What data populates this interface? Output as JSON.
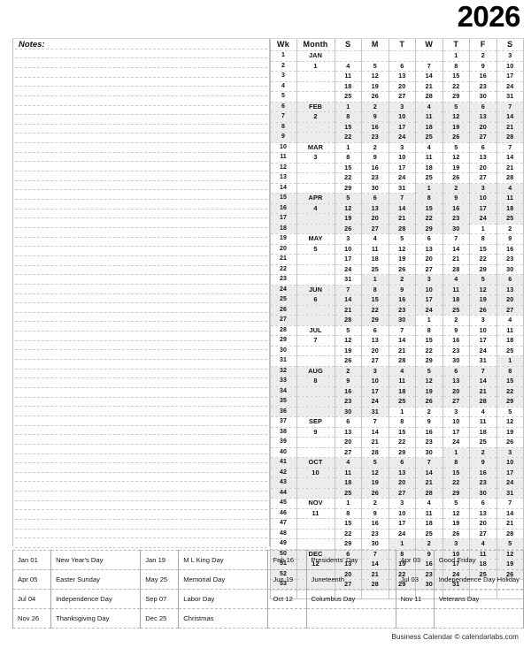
{
  "year": "2026",
  "notes": {
    "label": "Notes:",
    "line_count": 54
  },
  "footer": "Business Calendar © calendarlabs.com",
  "calendar": {
    "headers": [
      "Wk",
      "Month",
      "S",
      "M",
      "T",
      "W",
      "T",
      "F",
      "S"
    ],
    "month_names": [
      "JAN",
      "FEB",
      "MAR",
      "APR",
      "MAY",
      "JUN",
      "JUL",
      "AUG",
      "SEP",
      "OCT",
      "NOV",
      "DEC"
    ],
    "rows": [
      {
        "wk": "1",
        "month": "JAN",
        "num": "",
        "days": [
          "",
          "",
          "",
          "",
          "1",
          "2",
          "3"
        ],
        "months": [
          0,
          0,
          0,
          0,
          1,
          1,
          1
        ]
      },
      {
        "wk": "2",
        "month": "",
        "num": "1",
        "days": [
          "4",
          "5",
          "6",
          "7",
          "8",
          "9",
          "10"
        ],
        "months": [
          1,
          1,
          1,
          1,
          1,
          1,
          1
        ]
      },
      {
        "wk": "3",
        "month": "",
        "num": "",
        "days": [
          "11",
          "12",
          "13",
          "14",
          "15",
          "16",
          "17"
        ],
        "months": [
          1,
          1,
          1,
          1,
          1,
          1,
          1
        ]
      },
      {
        "wk": "4",
        "month": "",
        "num": "",
        "days": [
          "18",
          "19",
          "20",
          "21",
          "22",
          "23",
          "24"
        ],
        "months": [
          1,
          1,
          1,
          1,
          1,
          1,
          1
        ]
      },
      {
        "wk": "5",
        "month": "",
        "num": "",
        "days": [
          "25",
          "26",
          "27",
          "28",
          "29",
          "30",
          "31"
        ],
        "months": [
          1,
          1,
          1,
          1,
          1,
          1,
          1
        ]
      },
      {
        "wk": "6",
        "month": "FEB",
        "num": "",
        "days": [
          "1",
          "2",
          "3",
          "4",
          "5",
          "6",
          "7"
        ],
        "months": [
          2,
          2,
          2,
          2,
          2,
          2,
          2
        ]
      },
      {
        "wk": "7",
        "month": "",
        "num": "2",
        "days": [
          "8",
          "9",
          "10",
          "11",
          "12",
          "13",
          "14"
        ],
        "months": [
          2,
          2,
          2,
          2,
          2,
          2,
          2
        ]
      },
      {
        "wk": "8",
        "month": "",
        "num": "",
        "days": [
          "15",
          "16",
          "17",
          "18",
          "19",
          "20",
          "21"
        ],
        "months": [
          2,
          2,
          2,
          2,
          2,
          2,
          2
        ]
      },
      {
        "wk": "9",
        "month": "",
        "num": "",
        "days": [
          "22",
          "23",
          "24",
          "25",
          "26",
          "27",
          "28"
        ],
        "months": [
          2,
          2,
          2,
          2,
          2,
          2,
          2
        ]
      },
      {
        "wk": "10",
        "month": "MAR",
        "num": "",
        "days": [
          "1",
          "2",
          "3",
          "4",
          "5",
          "6",
          "7"
        ],
        "months": [
          3,
          3,
          3,
          3,
          3,
          3,
          3
        ]
      },
      {
        "wk": "11",
        "month": "",
        "num": "3",
        "days": [
          "8",
          "9",
          "10",
          "11",
          "12",
          "13",
          "14"
        ],
        "months": [
          3,
          3,
          3,
          3,
          3,
          3,
          3
        ]
      },
      {
        "wk": "12",
        "month": "",
        "num": "",
        "days": [
          "15",
          "16",
          "17",
          "18",
          "19",
          "20",
          "21"
        ],
        "months": [
          3,
          3,
          3,
          3,
          3,
          3,
          3
        ]
      },
      {
        "wk": "13",
        "month": "",
        "num": "",
        "days": [
          "22",
          "23",
          "24",
          "25",
          "26",
          "27",
          "28"
        ],
        "months": [
          3,
          3,
          3,
          3,
          3,
          3,
          3
        ]
      },
      {
        "wk": "14",
        "month": "",
        "num": "",
        "days": [
          "29",
          "30",
          "31",
          "1",
          "2",
          "3",
          "4"
        ],
        "months": [
          3,
          3,
          3,
          4,
          4,
          4,
          4
        ]
      },
      {
        "wk": "15",
        "month": "APR",
        "num": "",
        "days": [
          "5",
          "6",
          "7",
          "8",
          "9",
          "10",
          "11"
        ],
        "months": [
          4,
          4,
          4,
          4,
          4,
          4,
          4
        ]
      },
      {
        "wk": "16",
        "month": "",
        "num": "4",
        "days": [
          "12",
          "13",
          "14",
          "15",
          "16",
          "17",
          "18"
        ],
        "months": [
          4,
          4,
          4,
          4,
          4,
          4,
          4
        ]
      },
      {
        "wk": "17",
        "month": "",
        "num": "",
        "days": [
          "19",
          "20",
          "21",
          "22",
          "23",
          "24",
          "25"
        ],
        "months": [
          4,
          4,
          4,
          4,
          4,
          4,
          4
        ]
      },
      {
        "wk": "18",
        "month": "",
        "num": "",
        "days": [
          "26",
          "27",
          "28",
          "29",
          "30",
          "1",
          "2"
        ],
        "months": [
          4,
          4,
          4,
          4,
          4,
          5,
          5
        ]
      },
      {
        "wk": "19",
        "month": "MAY",
        "num": "",
        "days": [
          "3",
          "4",
          "5",
          "6",
          "7",
          "8",
          "9"
        ],
        "months": [
          5,
          5,
          5,
          5,
          5,
          5,
          5
        ]
      },
      {
        "wk": "20",
        "month": "",
        "num": "5",
        "days": [
          "10",
          "11",
          "12",
          "13",
          "14",
          "15",
          "16"
        ],
        "months": [
          5,
          5,
          5,
          5,
          5,
          5,
          5
        ]
      },
      {
        "wk": "21",
        "month": "",
        "num": "",
        "days": [
          "17",
          "18",
          "19",
          "20",
          "21",
          "22",
          "23"
        ],
        "months": [
          5,
          5,
          5,
          5,
          5,
          5,
          5
        ]
      },
      {
        "wk": "22",
        "month": "",
        "num": "",
        "days": [
          "24",
          "25",
          "26",
          "27",
          "28",
          "29",
          "30"
        ],
        "months": [
          5,
          5,
          5,
          5,
          5,
          5,
          5
        ]
      },
      {
        "wk": "23",
        "month": "",
        "num": "",
        "days": [
          "31",
          "1",
          "2",
          "3",
          "4",
          "5",
          "6"
        ],
        "months": [
          5,
          6,
          6,
          6,
          6,
          6,
          6
        ]
      },
      {
        "wk": "24",
        "month": "JUN",
        "num": "",
        "days": [
          "7",
          "8",
          "9",
          "10",
          "11",
          "12",
          "13"
        ],
        "months": [
          6,
          6,
          6,
          6,
          6,
          6,
          6
        ]
      },
      {
        "wk": "25",
        "month": "",
        "num": "6",
        "days": [
          "14",
          "15",
          "16",
          "17",
          "18",
          "19",
          "20"
        ],
        "months": [
          6,
          6,
          6,
          6,
          6,
          6,
          6
        ]
      },
      {
        "wk": "26",
        "month": "",
        "num": "",
        "days": [
          "21",
          "22",
          "23",
          "24",
          "25",
          "26",
          "27"
        ],
        "months": [
          6,
          6,
          6,
          6,
          6,
          6,
          6
        ]
      },
      {
        "wk": "27",
        "month": "",
        "num": "",
        "days": [
          "28",
          "29",
          "30",
          "1",
          "2",
          "3",
          "4"
        ],
        "months": [
          6,
          6,
          6,
          7,
          7,
          7,
          7
        ]
      },
      {
        "wk": "28",
        "month": "JUL",
        "num": "",
        "days": [
          "5",
          "6",
          "7",
          "8",
          "9",
          "10",
          "11"
        ],
        "months": [
          7,
          7,
          7,
          7,
          7,
          7,
          7
        ]
      },
      {
        "wk": "29",
        "month": "",
        "num": "7",
        "days": [
          "12",
          "13",
          "14",
          "15",
          "16",
          "17",
          "18"
        ],
        "months": [
          7,
          7,
          7,
          7,
          7,
          7,
          7
        ]
      },
      {
        "wk": "30",
        "month": "",
        "num": "",
        "days": [
          "19",
          "20",
          "21",
          "22",
          "23",
          "24",
          "25"
        ],
        "months": [
          7,
          7,
          7,
          7,
          7,
          7,
          7
        ]
      },
      {
        "wk": "31",
        "month": "",
        "num": "",
        "days": [
          "26",
          "27",
          "28",
          "29",
          "30",
          "31",
          "1"
        ],
        "months": [
          7,
          7,
          7,
          7,
          7,
          7,
          8
        ]
      },
      {
        "wk": "32",
        "month": "AUG",
        "num": "",
        "days": [
          "2",
          "3",
          "4",
          "5",
          "6",
          "7",
          "8"
        ],
        "months": [
          8,
          8,
          8,
          8,
          8,
          8,
          8
        ]
      },
      {
        "wk": "33",
        "month": "",
        "num": "8",
        "days": [
          "9",
          "10",
          "11",
          "12",
          "13",
          "14",
          "15"
        ],
        "months": [
          8,
          8,
          8,
          8,
          8,
          8,
          8
        ]
      },
      {
        "wk": "34",
        "month": "",
        "num": "",
        "days": [
          "16",
          "17",
          "18",
          "19",
          "20",
          "21",
          "22"
        ],
        "months": [
          8,
          8,
          8,
          8,
          8,
          8,
          8
        ]
      },
      {
        "wk": "35",
        "month": "",
        "num": "",
        "days": [
          "23",
          "24",
          "25",
          "26",
          "27",
          "28",
          "29"
        ],
        "months": [
          8,
          8,
          8,
          8,
          8,
          8,
          8
        ]
      },
      {
        "wk": "36",
        "month": "",
        "num": "",
        "days": [
          "30",
          "31",
          "1",
          "2",
          "3",
          "4",
          "5"
        ],
        "months": [
          8,
          8,
          9,
          9,
          9,
          9,
          9
        ]
      },
      {
        "wk": "37",
        "month": "SEP",
        "num": "",
        "days": [
          "6",
          "7",
          "8",
          "9",
          "10",
          "11",
          "12"
        ],
        "months": [
          9,
          9,
          9,
          9,
          9,
          9,
          9
        ]
      },
      {
        "wk": "38",
        "month": "",
        "num": "9",
        "days": [
          "13",
          "14",
          "15",
          "16",
          "17",
          "18",
          "19"
        ],
        "months": [
          9,
          9,
          9,
          9,
          9,
          9,
          9
        ]
      },
      {
        "wk": "39",
        "month": "",
        "num": "",
        "days": [
          "20",
          "21",
          "22",
          "23",
          "24",
          "25",
          "26"
        ],
        "months": [
          9,
          9,
          9,
          9,
          9,
          9,
          9
        ]
      },
      {
        "wk": "40",
        "month": "",
        "num": "",
        "days": [
          "27",
          "28",
          "29",
          "30",
          "1",
          "2",
          "3"
        ],
        "months": [
          9,
          9,
          9,
          9,
          10,
          10,
          10
        ]
      },
      {
        "wk": "41",
        "month": "OCT",
        "num": "",
        "days": [
          "4",
          "5",
          "6",
          "7",
          "8",
          "9",
          "10"
        ],
        "months": [
          10,
          10,
          10,
          10,
          10,
          10,
          10
        ]
      },
      {
        "wk": "42",
        "month": "",
        "num": "10",
        "days": [
          "11",
          "12",
          "13",
          "14",
          "15",
          "16",
          "17"
        ],
        "months": [
          10,
          10,
          10,
          10,
          10,
          10,
          10
        ]
      },
      {
        "wk": "43",
        "month": "",
        "num": "",
        "days": [
          "18",
          "19",
          "20",
          "21",
          "22",
          "23",
          "24"
        ],
        "months": [
          10,
          10,
          10,
          10,
          10,
          10,
          10
        ]
      },
      {
        "wk": "44",
        "month": "",
        "num": "",
        "days": [
          "25",
          "26",
          "27",
          "28",
          "29",
          "30",
          "31"
        ],
        "months": [
          10,
          10,
          10,
          10,
          10,
          10,
          10
        ]
      },
      {
        "wk": "45",
        "month": "NOV",
        "num": "",
        "days": [
          "1",
          "2",
          "3",
          "4",
          "5",
          "6",
          "7"
        ],
        "months": [
          11,
          11,
          11,
          11,
          11,
          11,
          11
        ]
      },
      {
        "wk": "46",
        "month": "",
        "num": "11",
        "days": [
          "8",
          "9",
          "10",
          "11",
          "12",
          "13",
          "14"
        ],
        "months": [
          11,
          11,
          11,
          11,
          11,
          11,
          11
        ]
      },
      {
        "wk": "47",
        "month": "",
        "num": "",
        "days": [
          "15",
          "16",
          "17",
          "18",
          "19",
          "20",
          "21"
        ],
        "months": [
          11,
          11,
          11,
          11,
          11,
          11,
          11
        ]
      },
      {
        "wk": "48",
        "month": "",
        "num": "",
        "days": [
          "22",
          "23",
          "24",
          "25",
          "26",
          "27",
          "28"
        ],
        "months": [
          11,
          11,
          11,
          11,
          11,
          11,
          11
        ]
      },
      {
        "wk": "49",
        "month": "",
        "num": "",
        "days": [
          "29",
          "30",
          "1",
          "2",
          "3",
          "4",
          "5"
        ],
        "months": [
          11,
          11,
          12,
          12,
          12,
          12,
          12
        ]
      },
      {
        "wk": "50",
        "month": "DEC",
        "num": "",
        "days": [
          "6",
          "7",
          "8",
          "9",
          "10",
          "11",
          "12"
        ],
        "months": [
          12,
          12,
          12,
          12,
          12,
          12,
          12
        ]
      },
      {
        "wk": "51",
        "month": "",
        "num": "12",
        "days": [
          "13",
          "14",
          "15",
          "16",
          "17",
          "18",
          "19"
        ],
        "months": [
          12,
          12,
          12,
          12,
          12,
          12,
          12
        ]
      },
      {
        "wk": "52",
        "month": "",
        "num": "",
        "days": [
          "20",
          "21",
          "22",
          "23",
          "24",
          "25",
          "26"
        ],
        "months": [
          12,
          12,
          12,
          12,
          12,
          12,
          12
        ]
      },
      {
        "wk": "53",
        "month": "",
        "num": "",
        "days": [
          "27",
          "28",
          "29",
          "30",
          "31",
          "",
          ""
        ],
        "months": [
          12,
          12,
          12,
          12,
          12,
          0,
          0
        ]
      },
      {
        "wk": "",
        "month": "",
        "num": "",
        "days": [
          "",
          "",
          "",
          "",
          "",
          "",
          ""
        ],
        "months": [
          0,
          0,
          0,
          0,
          0,
          0,
          0
        ]
      }
    ]
  },
  "holidays": [
    [
      {
        "date": "Jan 01",
        "name": "New Year's Day"
      },
      {
        "date": "Jan 19",
        "name": "M L King Day"
      },
      {
        "date": "Feb 16",
        "name": "Presidents' Day"
      },
      {
        "date": "Apr 03",
        "name": "Good Friday"
      }
    ],
    [
      {
        "date": "Apr 05",
        "name": "Easter Sunday"
      },
      {
        "date": "May 25",
        "name": "Memorial Day"
      },
      {
        "date": "Jun 19",
        "name": "Juneteenth"
      },
      {
        "date": "Jul  03",
        "name": "Independence Day Holiday"
      }
    ],
    [
      {
        "date": "Jul  04",
        "name": "Independence Day"
      },
      {
        "date": "Sep 07",
        "name": "Labor Day"
      },
      {
        "date": "Oct 12",
        "name": "Columbus Day"
      },
      {
        "date": "Nov 11",
        "name": "Veterans Day"
      }
    ],
    [
      {
        "date": "Nov 26",
        "name": "Thanksgiving Day"
      },
      {
        "date": "Dec 25",
        "name": "Christmas"
      },
      {
        "date": "",
        "name": ""
      },
      {
        "date": "",
        "name": ""
      }
    ]
  ]
}
